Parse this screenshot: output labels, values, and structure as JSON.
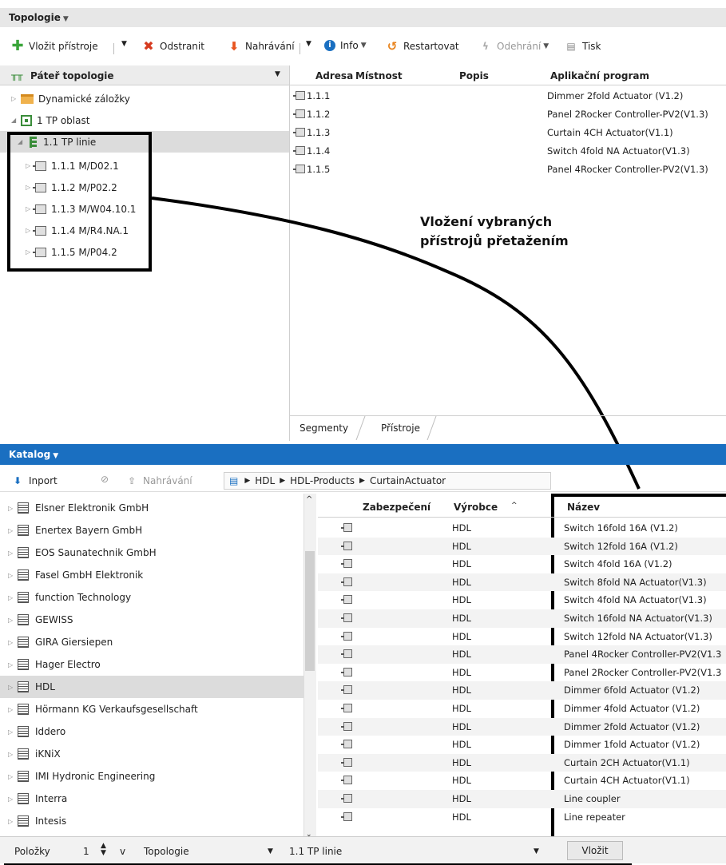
{
  "topologie": {
    "title": "Topologie"
  },
  "toolbar": {
    "insert": "Vložit přístroje",
    "remove": "Odstranit",
    "upload": "Nahrávání",
    "info": "Info",
    "restart": "Restartovat",
    "unload": "Odehrání",
    "print": "Tisk"
  },
  "tree": {
    "header": "Páteř topologie",
    "dynamic": "Dynamické záložky",
    "area": "1 TP oblast",
    "line": "1.1 TP linie",
    "devices": [
      "1.1.1 M/D02.1",
      "1.1.2 M/P02.2",
      "1.1.3 M/W04.10.1",
      "1.1.4 M/R4.NA.1",
      "1.1.5 M/P04.2"
    ]
  },
  "device_table": {
    "headers": [
      "Adresa",
      "Místnost",
      "Popis",
      "Aplikační program"
    ],
    "rows": [
      {
        "addr": "1.1.1",
        "app": "Dimmer 2fold Actuator (V1.2)"
      },
      {
        "addr": "1.1.2",
        "app": "Panel 2Rocker Controller-PV2(V1.3)"
      },
      {
        "addr": "1.1.3",
        "app": "Curtain 4CH Actuator(V1.1)"
      },
      {
        "addr": "1.1.4",
        "app": "Switch 4fold NA Actuator(V1.3)"
      },
      {
        "addr": "1.1.5",
        "app": "Panel 4Rocker Controller-PV2(V1.3)"
      }
    ]
  },
  "annotation": {
    "line1": "Vložení vybraných",
    "line2": "přístrojů přetažením"
  },
  "tabs": {
    "segments": "Segmenty",
    "devices": "Přístroje"
  },
  "katalog": {
    "title": "Katalog",
    "import": "Inport",
    "upload": "Nahrávání",
    "path": [
      "HDL",
      "HDL-Products",
      "CurtainActuator"
    ],
    "manufacturers": [
      "Elsner Elektronik GmbH",
      "Enertex Bayern GmbH",
      "EOS Saunatechnik GmbH",
      "Fasel GmbH Elektronik",
      "function Technology",
      "GEWISS",
      "GIRA Giersiepen",
      "Hager Electro",
      "HDL",
      "Hörmann KG Verkaufsgesellschaft",
      "Iddero",
      "iKNiX",
      "IMI Hydronic Engineering",
      "Interra",
      "Intesis"
    ],
    "table_headers": {
      "security": "Zabezpečení",
      "maker": "Výrobce",
      "name": "Název"
    },
    "products": [
      "Switch 16fold 16A (V1.2)",
      "Switch 12fold 16A (V1.2)",
      "Switch 4fold 16A (V1.2)",
      "Switch 8fold NA Actuator(V1.3)",
      "Switch 4fold NA Actuator(V1.3)",
      "Switch 16fold NA Actuator(V1.3)",
      "Switch 12fold NA Actuator(V1.3)",
      "Panel 4Rocker Controller-PV2(V1.3",
      "Panel 2Rocker Controller-PV2(V1.3",
      "Dimmer 6fold Actuator (V1.2)",
      "Dimmer 4fold Actuator (V1.2)",
      "Dimmer 2fold Actuator (V1.2)",
      "Dimmer 1fold Actuator (V1.2)",
      "Curtain 2CH Actuator(V1.1)",
      "Curtain 4CH Actuator(V1.1)",
      "Line coupler",
      "Line repeater"
    ],
    "maker_value": "HDL"
  },
  "bottom": {
    "items_label": "Položky",
    "count": "1",
    "in": "v",
    "target": "Topologie",
    "line": "1.1 TP linie",
    "insert": "Vložit"
  },
  "colors": {
    "katalog_blue": "#1a6fc1"
  }
}
